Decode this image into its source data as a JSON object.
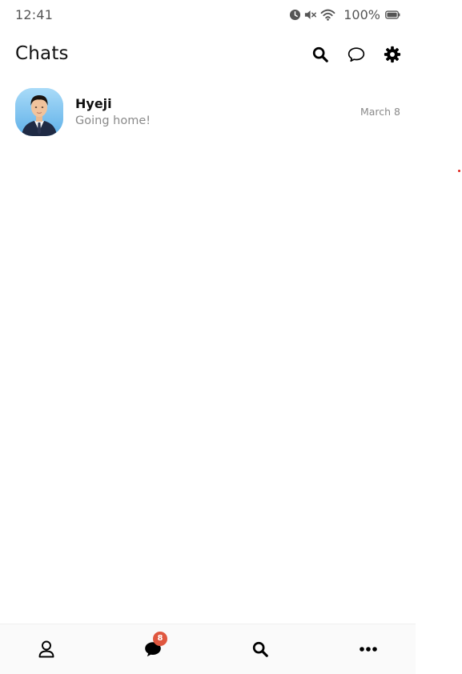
{
  "status_bar": {
    "time": "12:41",
    "battery": "100%",
    "icons": [
      "alarm-icon",
      "mute-icon",
      "wifi-icon",
      "battery-icon"
    ]
  },
  "header": {
    "title": "Chats",
    "actions": [
      "search-icon",
      "new-chat-icon",
      "settings-icon"
    ]
  },
  "chats": [
    {
      "name": "Hyeji",
      "preview": "Going home!",
      "date": "March 8",
      "avatar": "profile-photo"
    }
  ],
  "bottom_nav": {
    "items": [
      {
        "icon": "person-icon",
        "name": "friends"
      },
      {
        "icon": "chat-bubble-icon",
        "name": "chats",
        "badge": "8"
      },
      {
        "icon": "search-icon",
        "name": "search"
      },
      {
        "icon": "more-icon",
        "name": "more"
      }
    ]
  },
  "colors": {
    "badge": "#e0573f",
    "secondary_text": "#8a8a8a",
    "nav_background": "#fafafa"
  }
}
